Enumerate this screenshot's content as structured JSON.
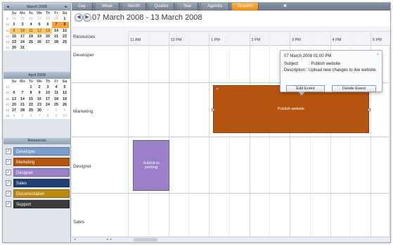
{
  "mini_calendars": [
    {
      "title": "March 2008",
      "days": [
        "Su",
        "Mo",
        "Tu",
        "We",
        "Th",
        "Fr",
        "Sa"
      ],
      "weeks": [
        {
          "wk": "9",
          "d": [
            [
              "24",
              "om"
            ],
            [
              "25",
              "om"
            ],
            [
              "26",
              "om"
            ],
            [
              "27",
              "om"
            ],
            [
              "28",
              "om"
            ],
            [
              "29",
              "om"
            ],
            [
              "1",
              "b"
            ]
          ]
        },
        {
          "wk": "10",
          "d": [
            [
              "2",
              "b"
            ],
            [
              "3",
              "b"
            ],
            [
              "4",
              "b"
            ],
            [
              "5",
              "b"
            ],
            [
              "6",
              "b"
            ],
            [
              "7",
              "hl"
            ],
            [
              "8",
              "hl"
            ]
          ]
        },
        {
          "wk": "11",
          "d": [
            [
              "9",
              "sel"
            ],
            [
              "10",
              "sel"
            ],
            [
              "11",
              "sel"
            ],
            [
              "12",
              "sel"
            ],
            [
              "13",
              "sel"
            ],
            [
              "14",
              "b"
            ],
            [
              "15",
              "b"
            ]
          ]
        },
        {
          "wk": "12",
          "d": [
            [
              "16",
              "b"
            ],
            [
              "17",
              "b"
            ],
            [
              "18",
              "b"
            ],
            [
              "19",
              "b"
            ],
            [
              "20",
              "b"
            ],
            [
              "21",
              "b"
            ],
            [
              "22",
              "b"
            ]
          ]
        },
        {
          "wk": "13",
          "d": [
            [
              "23",
              "b"
            ],
            [
              "24",
              "b"
            ],
            [
              "25",
              "b"
            ],
            [
              "26",
              "b"
            ],
            [
              "27",
              "b"
            ],
            [
              "28",
              "b"
            ],
            [
              "29",
              "b"
            ]
          ]
        },
        {
          "wk": "14",
          "d": [
            [
              "30",
              "b"
            ],
            [
              "31",
              "b"
            ],
            [
              "",
              ""
            ],
            [
              "",
              ""
            ],
            [
              "",
              ""
            ],
            [
              "",
              ""
            ],
            [
              "",
              ""
            ]
          ]
        }
      ]
    },
    {
      "title": "April 2008",
      "days": [
        "Su",
        "Mo",
        "Tu",
        "We",
        "Th",
        "Fr",
        "Sa"
      ],
      "weeks": [
        {
          "wk": "14",
          "d": [
            [
              "",
              ""
            ],
            [
              "",
              ""
            ],
            [
              "1",
              "b"
            ],
            [
              "2",
              "b"
            ],
            [
              "3",
              "b"
            ],
            [
              "4",
              "b"
            ],
            [
              "5",
              "b"
            ]
          ]
        },
        {
          "wk": "15",
          "d": [
            [
              "6",
              "b"
            ],
            [
              "7",
              "b"
            ],
            [
              "8",
              "b"
            ],
            [
              "9",
              "b"
            ],
            [
              "10",
              "b"
            ],
            [
              "11",
              "b"
            ],
            [
              "12",
              "b"
            ]
          ]
        },
        {
          "wk": "16",
          "d": [
            [
              "13",
              "b"
            ],
            [
              "14",
              "b"
            ],
            [
              "15",
              "b"
            ],
            [
              "16",
              "b"
            ],
            [
              "17",
              "b"
            ],
            [
              "18",
              "b"
            ],
            [
              "19",
              "b"
            ]
          ]
        },
        {
          "wk": "17",
          "d": [
            [
              "20",
              "b"
            ],
            [
              "21",
              "b"
            ],
            [
              "22",
              "b"
            ],
            [
              "23",
              "b"
            ],
            [
              "24",
              "b"
            ],
            [
              "25",
              "b"
            ],
            [
              "26",
              "b"
            ]
          ]
        },
        {
          "wk": "18",
          "d": [
            [
              "27",
              "b"
            ],
            [
              "28",
              "b"
            ],
            [
              "29",
              "b"
            ],
            [
              "30",
              "b"
            ],
            [
              "1",
              "om"
            ],
            [
              "2",
              "om"
            ],
            [
              "3",
              "om"
            ]
          ]
        },
        {
          "wk": "19",
          "d": [
            [
              "4",
              "om"
            ],
            [
              "5",
              "om"
            ],
            [
              "6",
              "om"
            ],
            [
              "7",
              "om"
            ],
            [
              "8",
              "om"
            ],
            [
              "9",
              "om"
            ],
            [
              "10",
              "om"
            ]
          ]
        }
      ]
    }
  ],
  "resources_panel": {
    "title": "Resources",
    "items": [
      {
        "label": "Developer",
        "color": "#7a9ccf",
        "checked": "✓"
      },
      {
        "label": "Marketing",
        "color": "#b5540e",
        "checked": "✓"
      },
      {
        "label": "Designer",
        "color": "#9a80c9",
        "checked": "✓"
      },
      {
        "label": "Sales",
        "color": "#1f3f73",
        "checked": "✓"
      },
      {
        "label": "Documentation",
        "color": "#b88a10",
        "checked": "✓"
      },
      {
        "label": "Support",
        "color": "#3a3a3a",
        "checked": "✓"
      }
    ]
  },
  "tabs": [
    {
      "label": "Day",
      "active": false
    },
    {
      "label": "Week",
      "active": false
    },
    {
      "label": "Month",
      "active": false
    },
    {
      "label": "Quarter",
      "active": false
    },
    {
      "label": "Year",
      "active": false
    },
    {
      "label": "Agenda",
      "active": false
    },
    {
      "label": "Timeline",
      "active": true
    }
  ],
  "date_range": "07 March 2008 - 13 March 2008",
  "grid": {
    "resources_label": "Resources",
    "times": [
      "11 AM",
      "12 PM",
      "1 PM",
      "2 PM",
      "3 PM",
      "4 PM",
      "5 PM"
    ],
    "rows": [
      "Developer",
      "Marketing",
      "Designer",
      "Sales"
    ]
  },
  "events": {
    "publish": "Publish website",
    "submit_line1": "Submit to",
    "submit_line2": "printing"
  },
  "tooltip": {
    "date": "07 March 2008 01:00 PM",
    "subject_label": "Subject",
    "subject_value": ": Publish website",
    "description": "Description : Upload new changes to live website.",
    "edit_button": "Edit Event",
    "delete_button": "Delete Event",
    "close": "×"
  }
}
